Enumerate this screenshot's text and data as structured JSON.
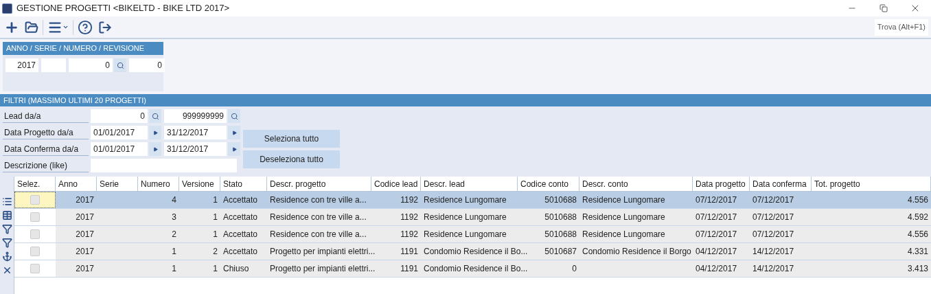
{
  "window": {
    "title": "GESTIONE PROGETTI <BIKELTD - BIKE LTD 2017>"
  },
  "toolbar": {
    "find_button": "Trova (Alt+F1)"
  },
  "key_panel": {
    "header": "ANNO / SERIE / NUMERO / REVISIONE",
    "fields": [
      {
        "value": "2017",
        "kind": "plain"
      },
      {
        "kind": "plain"
      },
      {
        "value": "0",
        "kind": "search"
      },
      {
        "value": "0",
        "kind": "plain"
      }
    ]
  },
  "filters": {
    "header": "FILTRI (MASSIMO ULTIMI 20 PROGETTI)",
    "rows": [
      {
        "label": "Lead da/a",
        "kind": "search",
        "from": "0",
        "to": "999999999"
      },
      {
        "label": "Data Progetto da/a",
        "kind": "date",
        "from": "01/01/2017",
        "to": "31/12/2017"
      },
      {
        "label": "Data Conferma da/a",
        "kind": "date",
        "from": "01/01/2017",
        "to": "31/12/2017"
      },
      {
        "label": "Descrizione (like)",
        "kind": "text"
      }
    ],
    "buttons": [
      "Seleziona tutto",
      "Deseleziona tutto"
    ]
  },
  "grid": {
    "check_column": "Selez.",
    "columns": [
      "Anno",
      "Serie",
      "Numero",
      "Versione",
      "Stato",
      "Descr. progetto",
      "Codice lead",
      "Descr. lead",
      "Codice conto",
      "Descr. conto",
      "Data progetto",
      "Data conferma",
      "Tot. progetto"
    ],
    "rows": [
      {
        "selected": true,
        "checked": false,
        "cells": [
          "2017",
          "",
          "4",
          "1",
          "Accettato",
          "Residence con tre ville a...",
          "1192",
          "Residence Lungomare",
          "5010688",
          "Residence Lungomare",
          "07/12/2017",
          "07/12/2017",
          "4.556"
        ]
      },
      {
        "selected": false,
        "checked": false,
        "cells": [
          "2017",
          "",
          "3",
          "1",
          "Accettato",
          "Residence con tre ville a...",
          "1192",
          "Residence Lungomare",
          "5010688",
          "Residence Lungomare",
          "07/12/2017",
          "07/12/2017",
          "4.592"
        ]
      },
      {
        "selected": false,
        "checked": false,
        "cells": [
          "2017",
          "",
          "2",
          "1",
          "Accettato",
          "Residence con tre ville a...",
          "1192",
          "Residence Lungomare",
          "5010688",
          "Residence Lungomare",
          "07/12/2017",
          "07/12/2017",
          "4.556"
        ]
      },
      {
        "selected": false,
        "checked": false,
        "cells": [
          "2017",
          "",
          "1",
          "2",
          "Accettato",
          "Progetto per impianti elettri...",
          "1191",
          "Condomio Residence il Bo...",
          "5010687",
          "Condomio Residence il Borgo",
          "04/12/2017",
          "14/12/2017",
          "4.331"
        ]
      },
      {
        "selected": false,
        "checked": false,
        "cells": [
          "2017",
          "",
          "1",
          "1",
          "Chiuso",
          "Progetto per impianti elettri...",
          "1191",
          "Condomio Residence il Bo...",
          "0",
          "",
          "04/12/2017",
          "14/12/2017",
          "3.413"
        ]
      }
    ]
  }
}
